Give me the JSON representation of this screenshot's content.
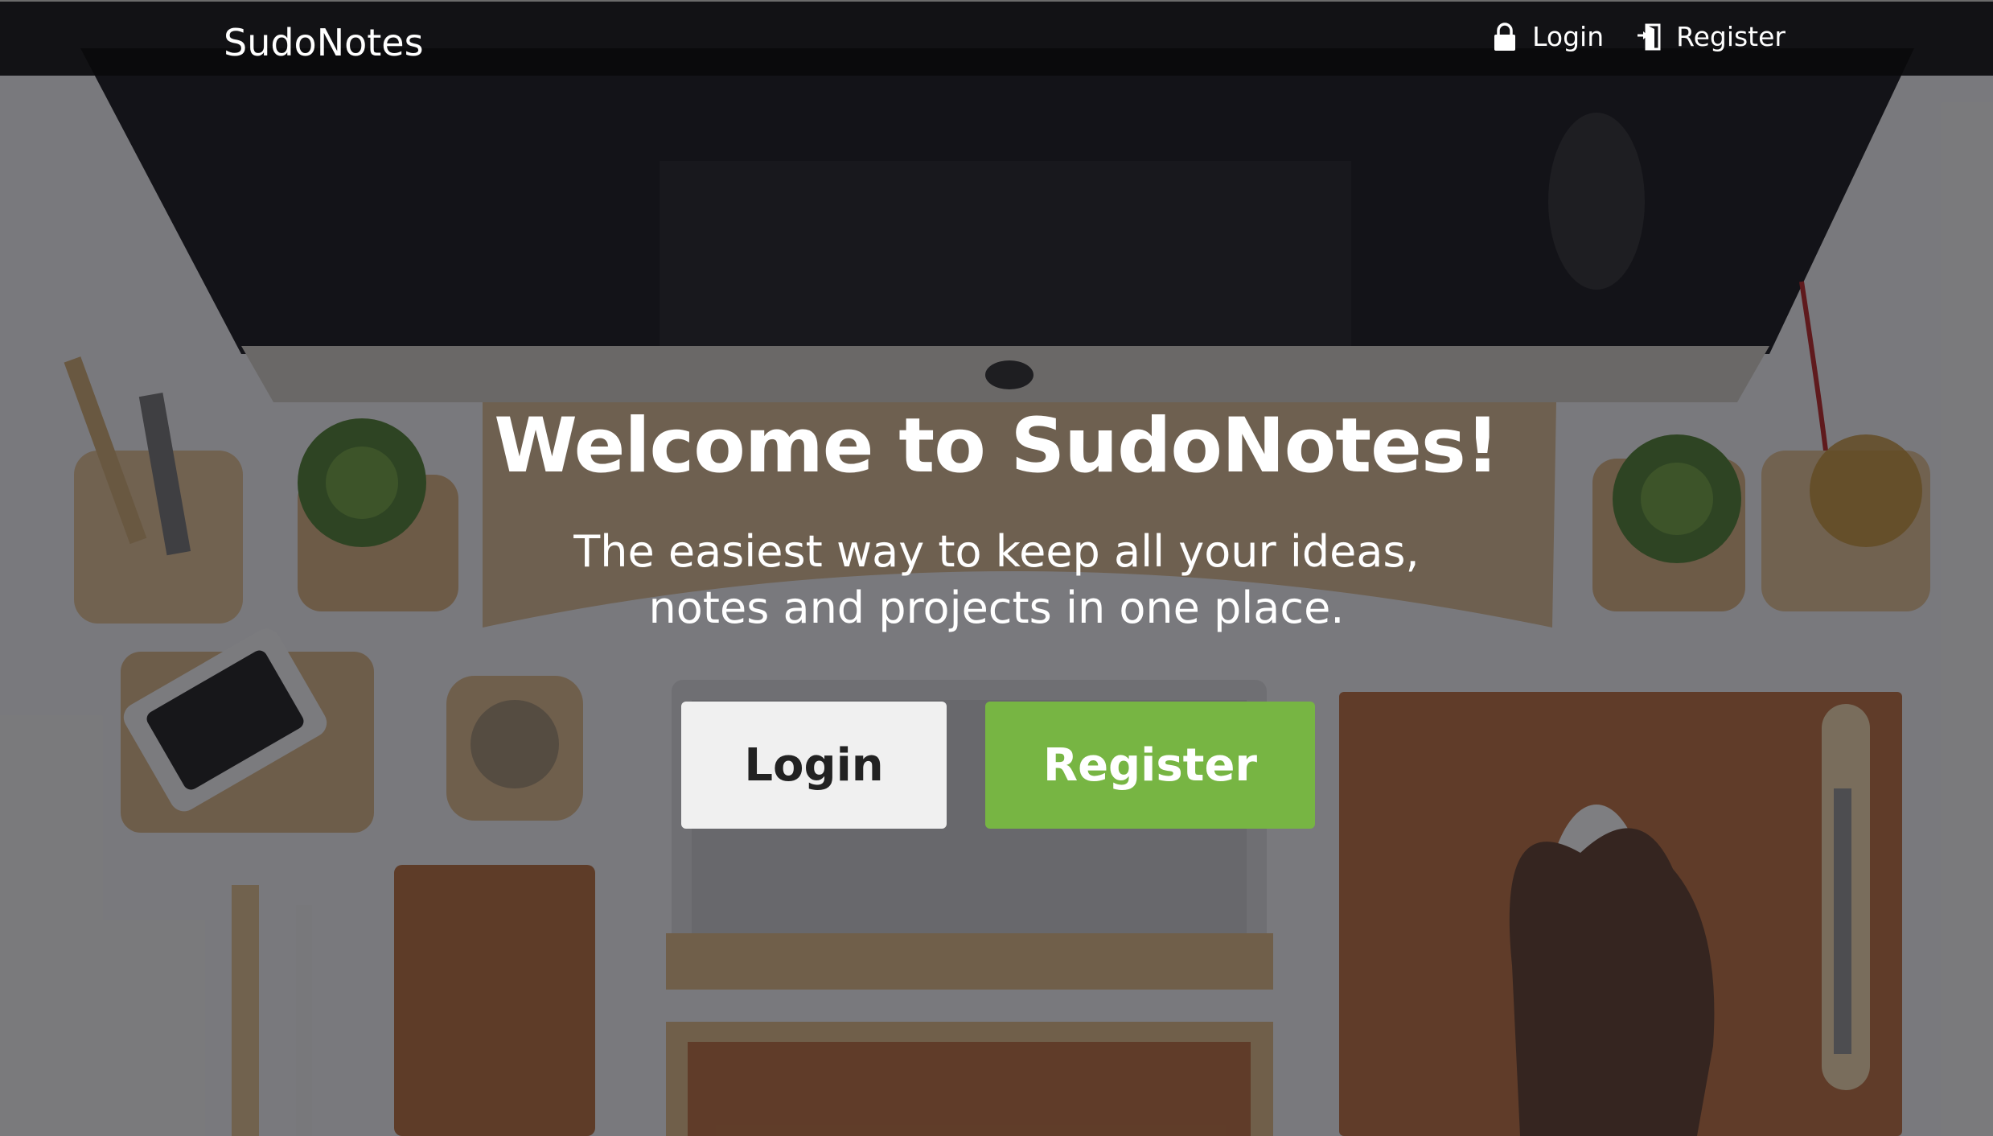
{
  "navbar": {
    "brand": "SudoNotes",
    "links": [
      {
        "label": "Login",
        "icon": "lock-icon"
      },
      {
        "label": "Register",
        "icon": "door-enter-icon"
      }
    ]
  },
  "hero": {
    "title": "Welcome to SudoNotes!",
    "subtitle_line1": "The easiest way to keep all your ideas,",
    "subtitle_line2": "notes and projects in one place.",
    "login_button": "Login",
    "register_button": "Register"
  },
  "colors": {
    "navbar_bg": "#0a0a0c",
    "register_button": "#77b543",
    "login_button": "#f0f0f0",
    "text": "#ffffff"
  }
}
